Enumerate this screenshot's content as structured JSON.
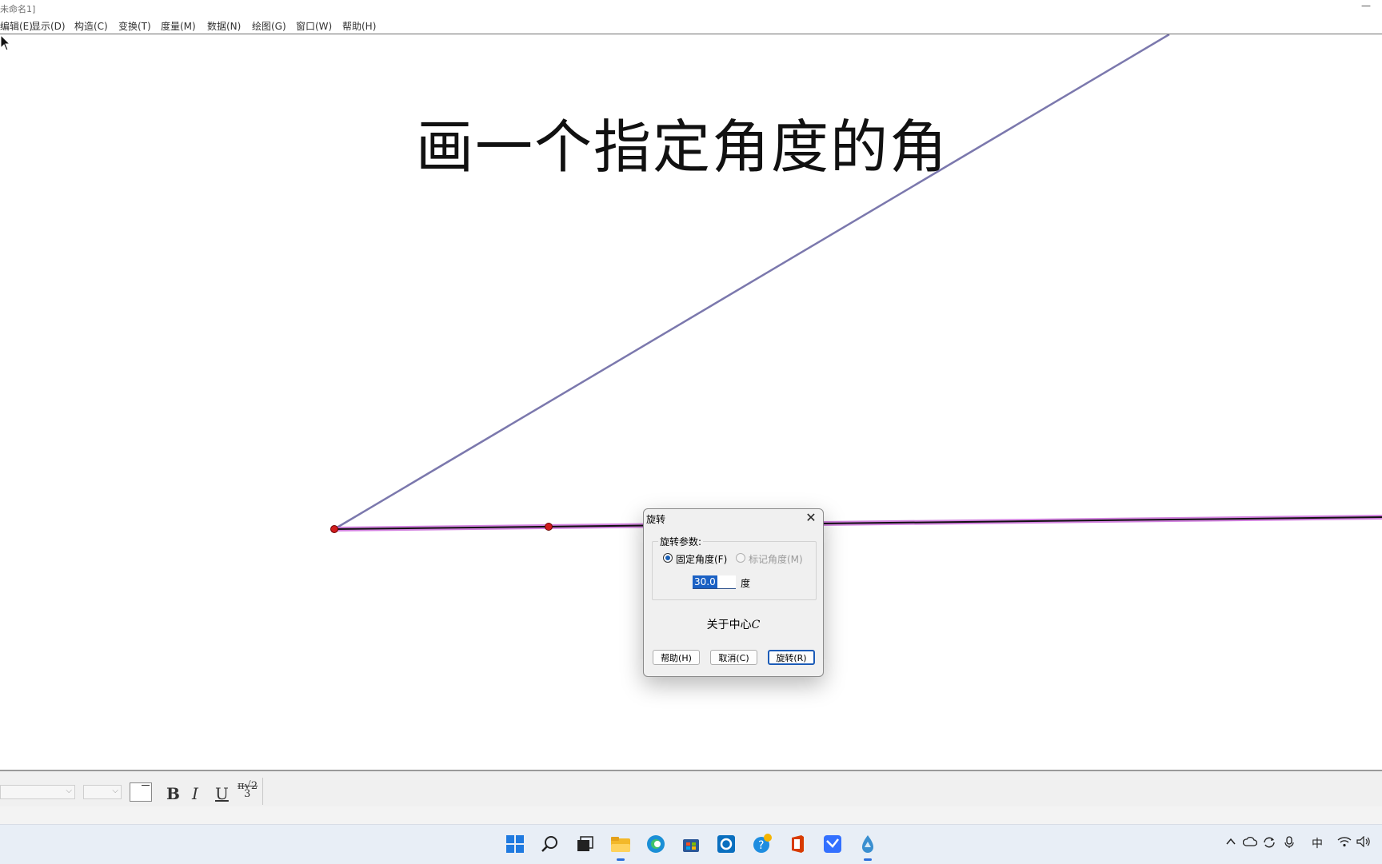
{
  "window": {
    "title": "未命名1]",
    "minimize_glyph": "—"
  },
  "menubar": {
    "items": [
      {
        "label": "编辑(E)"
      },
      {
        "label": "显示(D)"
      },
      {
        "label": "构造(C)"
      },
      {
        "label": "变换(T)"
      },
      {
        "label": "度量(M)"
      },
      {
        "label": "数据(N)"
      },
      {
        "label": "绘图(G)"
      },
      {
        "label": "窗口(W)"
      },
      {
        "label": "帮助(H)"
      }
    ]
  },
  "canvas": {
    "title": "画一个指定角度的角",
    "colors": {
      "ray_line": "#7b78ad",
      "base_line": "#111111",
      "base_highlight": "#c864d8",
      "point": "#d01c1c"
    }
  },
  "dialog": {
    "title": "旋转",
    "close_glyph": "✕",
    "group_label": "旋转参数:",
    "fixed_angle_label": "固定角度(F)",
    "marked_angle_label": "标记角度(M)",
    "angle_value": "30.0",
    "angle_unit": "度",
    "center_prefix": "关于中心",
    "center_name": "C",
    "buttons": {
      "help": "帮助(H)",
      "cancel": "取消(C)",
      "rotate": "旋转(R)"
    }
  },
  "format_bar": {
    "dropdown_arrow": "⌵",
    "bold": "B",
    "italic": "I",
    "underline": "U",
    "math_top": "π√2",
    "math_bottom": "3"
  },
  "taskbar": {
    "tray": {
      "ime": "中"
    },
    "colors": {
      "accent": "#2a6fdb"
    }
  }
}
